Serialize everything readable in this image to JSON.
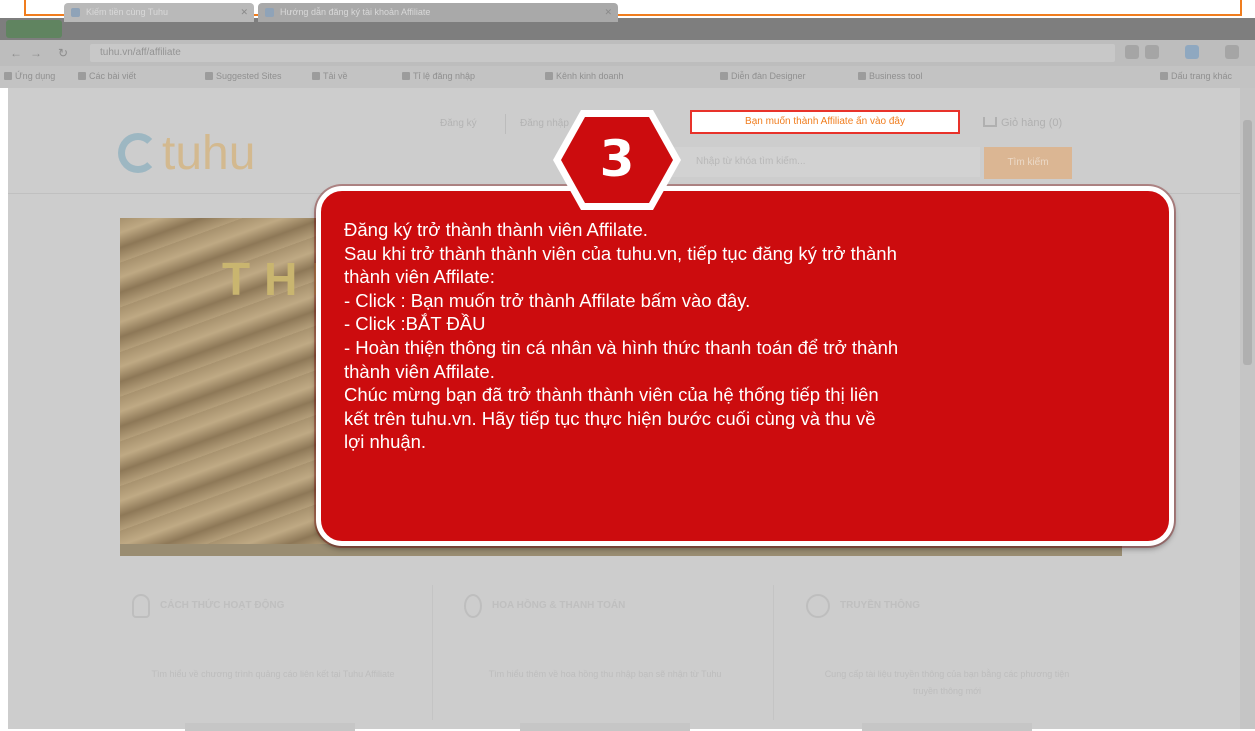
{
  "browser": {
    "tabs": [
      {
        "label": "Kiếm tiền cùng Tuhu"
      },
      {
        "label": "Hướng dẫn đăng ký tài khoản Affiliate"
      }
    ],
    "url": "tuhu.vn/aff/affiliate",
    "bookmarks": [
      "Ứng dụng",
      "Các bài viết",
      "Suggested Sites",
      "Tải về",
      "Tỉ lệ đăng nhập",
      "Kênh kinh doanh",
      "Diễn đàn Designer",
      "Business tool",
      "Dấu trang khác"
    ]
  },
  "site": {
    "logo": "tuhu",
    "header_links": [
      "Đăng ký",
      "Đăng nhập"
    ],
    "affiliate_link": "Bạn muốn thành Affiliate ấn vào đây",
    "cart": "Giỏ hàng (0)",
    "search_placeholder": "Nhập từ khóa tìm kiếm...",
    "search_button": "Tìm kiếm",
    "banner_word": "THI",
    "features": [
      {
        "title": "CÁCH THỨC HOẠT ĐỘNG",
        "desc": "Tìm hiểu về chương trình quảng cáo liên kết tại Tuhu Affiliate"
      },
      {
        "title": "HOA HỒNG & THANH TOÁN",
        "desc": "Tìm hiểu thêm về hoa hồng thu nhập bạn sẽ nhận từ Tuhu"
      },
      {
        "title": "TRUYỀN THÔNG",
        "desc": "Cung cấp tài liệu truyền thông của bạn bằng các phương tiện truyền thông mới"
      }
    ]
  },
  "tutorial": {
    "step_number": "3",
    "lines": [
      "Đăng ký trở thành thành viên Affilate.",
      "Sau khi trở thành thành viên của tuhu.vn, tiếp tục đăng ký trở thành",
      "thành viên Affilate:",
      "- Click : Bạn muốn trở thành Affilate bấm vào đây.",
      "- Click :BẮT ĐẦU",
      "- Hoàn thiện thông tin cá nhân và hình thức thanh toán để trở thành",
      "thành viên Affilate.",
      "Chúc mừng bạn đã trở thành thành viên của hệ thống tiếp thị liên",
      "kết trên tuhu.vn. Hãy tiếp tục thực hiện bước cuối cùng và thu về",
      "lợi nhuận."
    ]
  },
  "colors": {
    "callout_red": "#cc0c0e",
    "highlight_orange": "#f07d1e",
    "affiliate_border": "#e8322a"
  }
}
